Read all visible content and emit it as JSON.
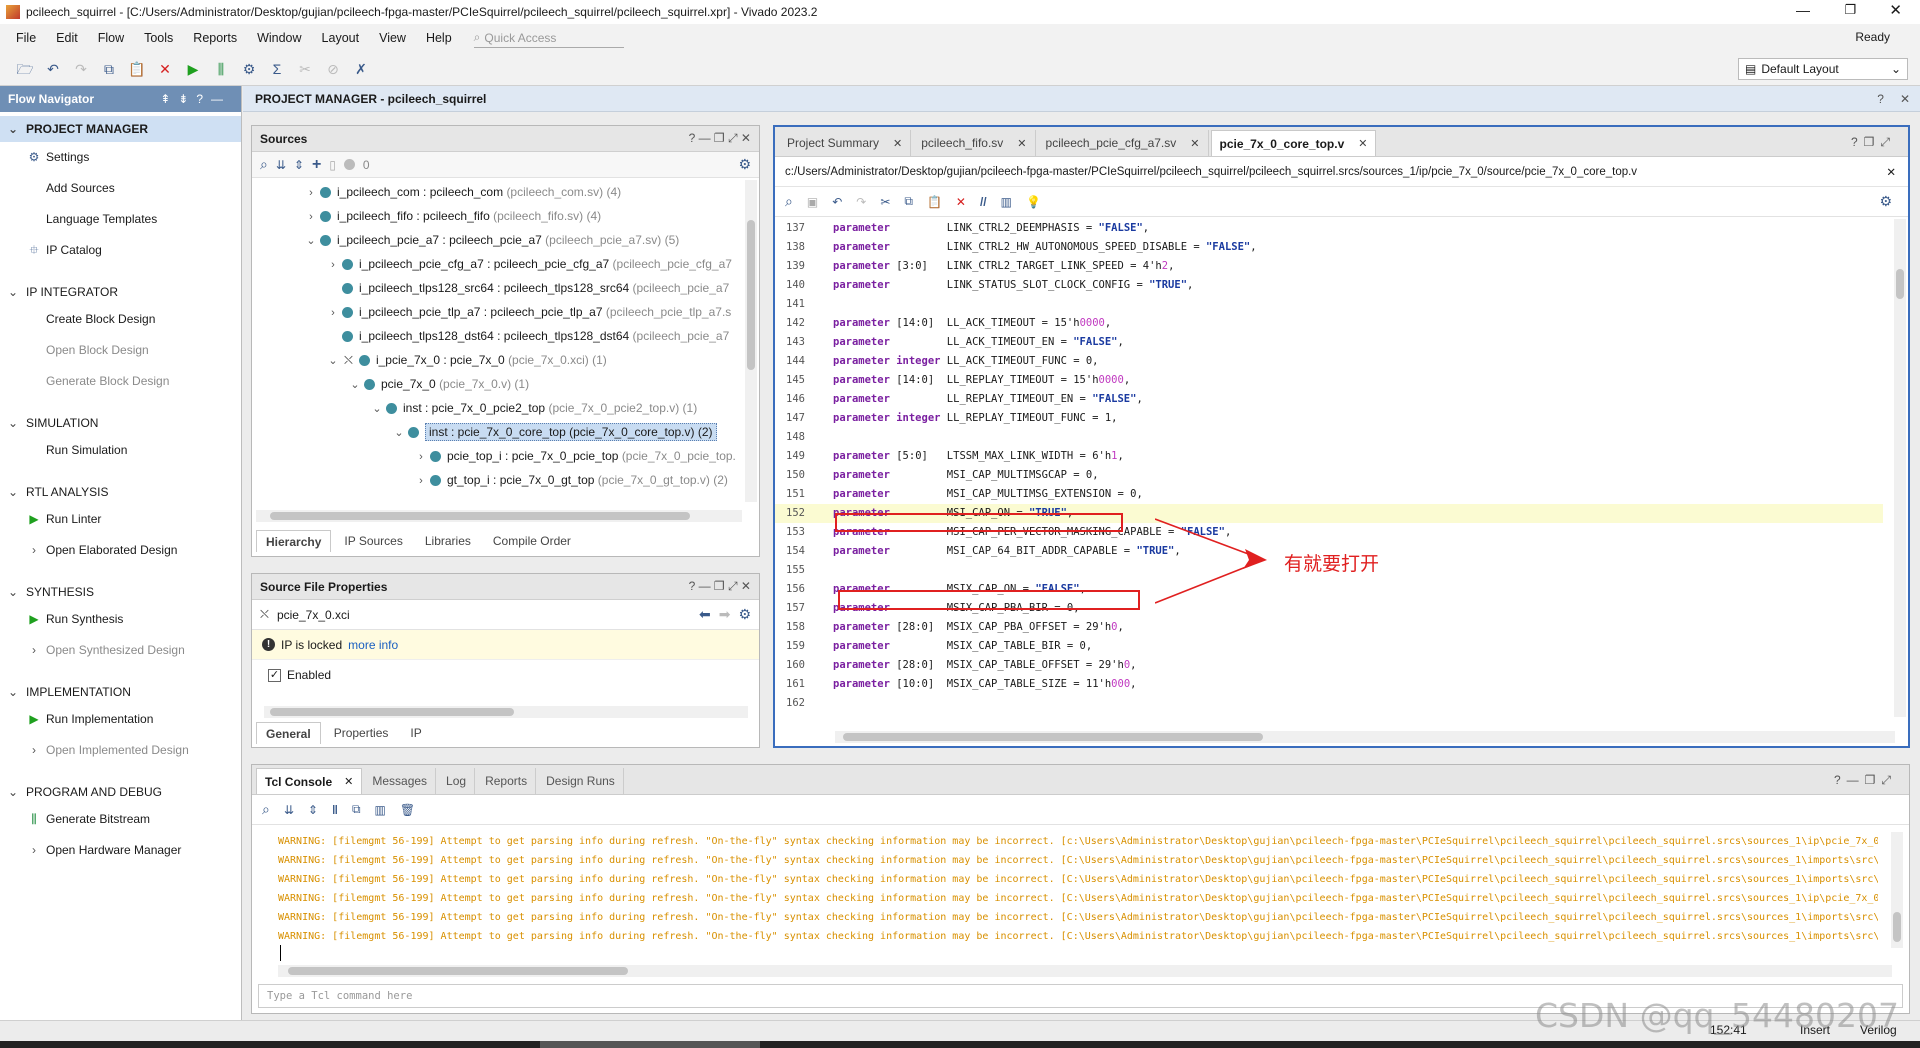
{
  "window": {
    "title": "pcileech_squirrel - [C:/Users/Administrator/Desktop/gujian/pcileech-fpga-master/PCIeSquirrel/pcileech_squirrel/pcileech_squirrel.xpr] - Vivado 2023.2",
    "status": "Ready"
  },
  "menu": [
    "File",
    "Edit",
    "Flow",
    "Tools",
    "Reports",
    "Window",
    "Layout",
    "View",
    "Help"
  ],
  "quick_access_placeholder": "Quick Access",
  "layout_select": "Default Layout",
  "flow_navigator": {
    "title": "Flow Navigator",
    "sections": [
      {
        "label": "PROJECT MANAGER",
        "items": [
          {
            "label": "Settings",
            "icon": "gear-icon",
            "disabled": false
          },
          {
            "label": "Add Sources",
            "icon": "",
            "disabled": false
          },
          {
            "label": "Language Templates",
            "icon": "",
            "disabled": false
          },
          {
            "label": "IP Catalog",
            "icon": "ip-catalog-icon",
            "disabled": false
          }
        ]
      },
      {
        "label": "IP INTEGRATOR",
        "items": [
          {
            "label": "Create Block Design",
            "icon": "",
            "disabled": false
          },
          {
            "label": "Open Block Design",
            "icon": "",
            "disabled": true
          },
          {
            "label": "Generate Block Design",
            "icon": "",
            "disabled": true
          }
        ]
      },
      {
        "label": "SIMULATION",
        "items": [
          {
            "label": "Run Simulation",
            "icon": "",
            "disabled": false
          }
        ]
      },
      {
        "label": "RTL ANALYSIS",
        "items": [
          {
            "label": "Run Linter",
            "icon": "run-icon",
            "disabled": false
          },
          {
            "label": "Open Elaborated Design",
            "icon": "chevron-right-icon",
            "disabled": false
          }
        ]
      },
      {
        "label": "SYNTHESIS",
        "items": [
          {
            "label": "Run Synthesis",
            "icon": "run-icon",
            "disabled": false
          },
          {
            "label": "Open Synthesized Design",
            "icon": "chevron-right-icon",
            "disabled": true
          }
        ]
      },
      {
        "label": "IMPLEMENTATION",
        "items": [
          {
            "label": "Run Implementation",
            "icon": "run-icon",
            "disabled": false
          },
          {
            "label": "Open Implemented Design",
            "icon": "chevron-right-icon",
            "disabled": true
          }
        ]
      },
      {
        "label": "PROGRAM AND DEBUG",
        "items": [
          {
            "label": "Generate Bitstream",
            "icon": "bitstream-icon",
            "disabled": false
          },
          {
            "label": "Open Hardware Manager",
            "icon": "chevron-right-icon",
            "disabled": false
          }
        ]
      }
    ]
  },
  "project_manager_title": "PROJECT MANAGER - pcileech_squirrel",
  "sources": {
    "title": "Sources",
    "count": "0",
    "tree": [
      {
        "indent": 0,
        "chev": "›",
        "name": "i_pcileech_com : pcileech_com",
        "file": "(pcileech_com.sv) (4)"
      },
      {
        "indent": 0,
        "chev": "›",
        "name": "i_pcileech_fifo : pcileech_fifo",
        "file": "(pcileech_fifo.sv) (4)"
      },
      {
        "indent": 0,
        "chev": "⌄",
        "name": "i_pcileech_pcie_a7 : pcileech_pcie_a7",
        "file": "(pcileech_pcie_a7.sv) (5)"
      },
      {
        "indent": 1,
        "chev": "›",
        "name": "i_pcileech_pcie_cfg_a7 : pcileech_pcie_cfg_a7",
        "file": "(pcileech_pcie_cfg_a7"
      },
      {
        "indent": 1,
        "chev": "",
        "name": "i_pcileech_tlps128_src64 : pcileech_tlps128_src64",
        "file": "(pcileech_pcie_a7"
      },
      {
        "indent": 1,
        "chev": "›",
        "name": "i_pcileech_pcie_tlp_a7 : pcileech_pcie_tlp_a7",
        "file": "(pcileech_pcie_tlp_a7.s"
      },
      {
        "indent": 1,
        "chev": "",
        "name": "i_pcileech_tlps128_dst64 : pcileech_tlps128_dst64",
        "file": "(pcileech_pcie_a7"
      },
      {
        "indent": 1,
        "chev": "⌄",
        "name": "i_pcie_7x_0 : pcie_7x_0",
        "file": "(pcie_7x_0.xci) (1)",
        "locked": true
      },
      {
        "indent": 2,
        "chev": "⌄",
        "name": "pcie_7x_0",
        "file": "(pcie_7x_0.v) (1)"
      },
      {
        "indent": 3,
        "chev": "⌄",
        "name": "inst : pcie_7x_0_pcie2_top",
        "file": "(pcie_7x_0_pcie2_top.v) (1)"
      },
      {
        "indent": 4,
        "chev": "⌄",
        "name": "inst : pcie_7x_0_core_top (pcie_7x_0_core_top.v) (2)",
        "file": "",
        "selected": true
      },
      {
        "indent": 5,
        "chev": "›",
        "name": "pcie_top_i : pcie_7x_0_pcie_top",
        "file": "(pcie_7x_0_pcie_top."
      },
      {
        "indent": 5,
        "chev": "›",
        "name": "gt_top_i : pcie_7x_0_gt_top",
        "file": "(pcie_7x_0_gt_top.v) (2)"
      }
    ],
    "tabs": [
      "Hierarchy",
      "IP Sources",
      "Libraries",
      "Compile Order"
    ]
  },
  "sfp": {
    "title": "Source File Properties",
    "file": "pcie_7x_0.xci",
    "locked_text": "IP is locked",
    "more_info": "more info",
    "enabled_label": "Enabled",
    "tabs": [
      "General",
      "Properties",
      "IP"
    ]
  },
  "editor": {
    "tabs": [
      "Project Summary",
      "pcileech_fifo.sv",
      "pcileech_pcie_cfg_a7.sv",
      "pcie_7x_0_core_top.v"
    ],
    "path": "c:/Users/Administrator/Desktop/gujian/pcileech-fpga-master/PCIeSquirrel/pcileech_squirrel/pcileech_squirrel.srcs/sources_1/ip/pcie_7x_0/source/pcie_7x_0_core_top.v",
    "lines": [
      {
        "n": "137",
        "t": [
          [
            "kw",
            "parameter"
          ],
          [
            "",
            "         LINK_CTRL2_DEEMPHASIS = "
          ],
          [
            "str",
            "\"FALSE\""
          ],
          [
            "",
            ","
          ]
        ]
      },
      {
        "n": "138",
        "t": [
          [
            "kw",
            "parameter"
          ],
          [
            "",
            "         LINK_CTRL2_HW_AUTONOMOUS_SPEED_DISABLE = "
          ],
          [
            "str",
            "\"FALSE\""
          ],
          [
            "",
            ","
          ]
        ]
      },
      {
        "n": "139",
        "t": [
          [
            "kw",
            "parameter"
          ],
          [
            "",
            " [3:0]   LINK_CTRL2_TARGET_LINK_SPEED = 4'h"
          ],
          [
            "hex",
            "2"
          ],
          [
            "",
            ","
          ]
        ]
      },
      {
        "n": "140",
        "t": [
          [
            "kw",
            "parameter"
          ],
          [
            "",
            "         LINK_STATUS_SLOT_CLOCK_CONFIG = "
          ],
          [
            "str",
            "\"TRUE\""
          ],
          [
            "",
            ","
          ]
        ]
      },
      {
        "n": "141",
        "t": []
      },
      {
        "n": "142",
        "t": [
          [
            "kw",
            "parameter"
          ],
          [
            "",
            " [14:0]  LL_ACK_TIMEOUT = 15'h"
          ],
          [
            "hex",
            "0000"
          ],
          [
            "",
            ","
          ]
        ]
      },
      {
        "n": "143",
        "t": [
          [
            "kw",
            "parameter"
          ],
          [
            "",
            "         LL_ACK_TIMEOUT_EN = "
          ],
          [
            "str",
            "\"FALSE\""
          ],
          [
            "",
            ","
          ]
        ]
      },
      {
        "n": "144",
        "t": [
          [
            "kw",
            "parameter integer"
          ],
          [
            "",
            " LL_ACK_TIMEOUT_FUNC = 0,"
          ]
        ]
      },
      {
        "n": "145",
        "t": [
          [
            "kw",
            "parameter"
          ],
          [
            "",
            " [14:0]  LL_REPLAY_TIMEOUT = 15'h"
          ],
          [
            "hex",
            "0000"
          ],
          [
            "",
            ","
          ]
        ]
      },
      {
        "n": "146",
        "t": [
          [
            "kw",
            "parameter"
          ],
          [
            "",
            "         LL_REPLAY_TIMEOUT_EN = "
          ],
          [
            "str",
            "\"FALSE\""
          ],
          [
            "",
            ","
          ]
        ]
      },
      {
        "n": "147",
        "t": [
          [
            "kw",
            "parameter integer"
          ],
          [
            "",
            " LL_REPLAY_TIMEOUT_FUNC = 1,"
          ]
        ]
      },
      {
        "n": "148",
        "t": []
      },
      {
        "n": "149",
        "t": [
          [
            "kw",
            "parameter"
          ],
          [
            "",
            " [5:0]   LTSSM_MAX_LINK_WIDTH = 6'h"
          ],
          [
            "hex",
            "1"
          ],
          [
            "",
            ","
          ]
        ]
      },
      {
        "n": "150",
        "t": [
          [
            "kw",
            "parameter"
          ],
          [
            "",
            "         MSI_CAP_MULTIMSGCAP = 0,"
          ]
        ]
      },
      {
        "n": "151",
        "t": [
          [
            "kw",
            "parameter"
          ],
          [
            "",
            "         MSI_CAP_MULTIMSG_EXTENSION = 0,"
          ]
        ]
      },
      {
        "n": "152",
        "t": [
          [
            "kw",
            "parameter"
          ],
          [
            "",
            "         MSI_CAP_ON = "
          ],
          [
            "str",
            "\"TRUE\""
          ],
          [
            "",
            ","
          ]
        ],
        "hl": true
      },
      {
        "n": "153",
        "t": [
          [
            "kw",
            "parameter"
          ],
          [
            "",
            "         MSI_CAP_PER_VECTOR_MASKING_CAPABLE = "
          ],
          [
            "str",
            "\"FALSE\""
          ],
          [
            "",
            ","
          ]
        ]
      },
      {
        "n": "154",
        "t": [
          [
            "kw",
            "parameter"
          ],
          [
            "",
            "         MSI_CAP_64_BIT_ADDR_CAPABLE = "
          ],
          [
            "str",
            "\"TRUE\""
          ],
          [
            "",
            ","
          ]
        ]
      },
      {
        "n": "155",
        "t": []
      },
      {
        "n": "156",
        "t": [
          [
            "kw",
            "parameter"
          ],
          [
            "",
            "         MSIX_CAP_ON = "
          ],
          [
            "str",
            "\"FALSE\""
          ],
          [
            "",
            ","
          ]
        ]
      },
      {
        "n": "157",
        "t": [
          [
            "kw",
            "parameter"
          ],
          [
            "",
            "         MSIX_CAP_PBA_BIR = 0,"
          ]
        ]
      },
      {
        "n": "158",
        "t": [
          [
            "kw",
            "parameter"
          ],
          [
            "",
            " [28:0]  MSIX_CAP_PBA_OFFSET = 29'h"
          ],
          [
            "hex",
            "0"
          ],
          [
            "",
            ","
          ]
        ]
      },
      {
        "n": "159",
        "t": [
          [
            "kw",
            "parameter"
          ],
          [
            "",
            "         MSIX_CAP_TABLE_BIR = 0,"
          ]
        ]
      },
      {
        "n": "160",
        "t": [
          [
            "kw",
            "parameter"
          ],
          [
            "",
            " [28:0]  MSIX_CAP_TABLE_OFFSET = 29'h"
          ],
          [
            "hex",
            "0"
          ],
          [
            "",
            ","
          ]
        ]
      },
      {
        "n": "161",
        "t": [
          [
            "kw",
            "parameter"
          ],
          [
            "",
            " [10:0]  MSIX_CAP_TABLE_SIZE = 11'h"
          ],
          [
            "hex",
            "000"
          ],
          [
            "",
            ","
          ]
        ]
      },
      {
        "n": "162",
        "t": []
      }
    ],
    "annotation": "有就要打开"
  },
  "console": {
    "tabs": [
      "Tcl Console",
      "Messages",
      "Log",
      "Reports",
      "Design Runs"
    ],
    "lines": [
      "WARNING: [filemgmt 56-199] Attempt to get parsing info during refresh. \"On-the-fly\" syntax checking information may be incorrect. [c:\\Users\\Administrator\\Desktop\\gujian\\pcileech-fpga-master\\PCIeSquirrel\\pcileech_squirrel\\pcileech_squirrel.srcs\\sources_1\\ip\\pcie_7x_0\\",
      "WARNING: [filemgmt 56-199] Attempt to get parsing info during refresh. \"On-the-fly\" syntax checking information may be incorrect. [C:\\Users\\Administrator\\Desktop\\gujian\\pcileech-fpga-master\\PCIeSquirrel\\pcileech_squirrel\\pcileech_squirrel.srcs\\sources_1\\imports\\src\\p",
      "WARNING: [filemgmt 56-199] Attempt to get parsing info during refresh. \"On-the-fly\" syntax checking information may be incorrect. [C:\\Users\\Administrator\\Desktop\\gujian\\pcileech-fpga-master\\PCIeSquirrel\\pcileech_squirrel\\pcileech_squirrel.srcs\\sources_1\\imports\\src\\p",
      "WARNING: [filemgmt 56-199] Attempt to get parsing info during refresh. \"On-the-fly\" syntax checking information may be incorrect. [C:\\Users\\Administrator\\Desktop\\gujian\\pcileech-fpga-master\\PCIeSquirrel\\pcileech_squirrel\\pcileech_squirrel.srcs\\sources_1\\ip\\pcie_7x_0\\",
      "WARNING: [filemgmt 56-199] Attempt to get parsing info during refresh. \"On-the-fly\" syntax checking information may be incorrect. [C:\\Users\\Administrator\\Desktop\\gujian\\pcileech-fpga-master\\PCIeSquirrel\\pcileech_squirrel\\pcileech_squirrel.srcs\\sources_1\\imports\\src\\p",
      "WARNING: [filemgmt 56-199] Attempt to get parsing info during refresh. \"On-the-fly\" syntax checking information may be incorrect. [C:\\Users\\Administrator\\Desktop\\gujian\\pcileech-fpga-master\\PCIeSquirrel\\pcileech_squirrel\\pcileech_squirrel.srcs\\sources_1\\imports\\src\\p"
    ],
    "input_placeholder": "Type a Tcl command here"
  },
  "statusbar": {
    "position": "152:41",
    "mode": "Insert",
    "lang": "Verilog"
  },
  "watermark": "CSDN @qq_54480207"
}
